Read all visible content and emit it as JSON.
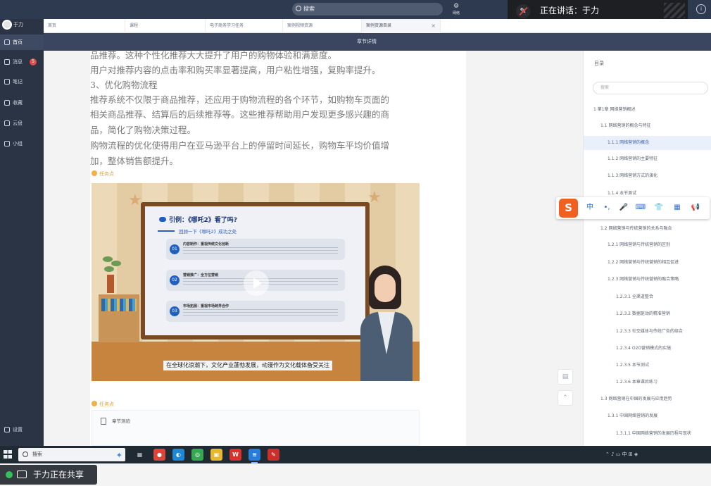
{
  "topbar": {
    "search_text": "搜索",
    "net_label": "网络",
    "speaking_text": "正在讲话：于力"
  },
  "sidebar": {
    "user_name": "于力",
    "items": [
      {
        "label": "首页",
        "active": true
      },
      {
        "label": "消息",
        "badge": "5"
      },
      {
        "label": "笔记"
      },
      {
        "label": "收藏"
      },
      {
        "label": "云盘"
      },
      {
        "label": "小组"
      }
    ],
    "settings_label": "设置"
  },
  "tabs": [
    {
      "label": "首页"
    },
    {
      "label": "课程"
    },
    {
      "label": "电子商务学习任务"
    },
    {
      "label": "案例视频资源"
    },
    {
      "label": "案例资源目录",
      "active": true,
      "close": "×"
    }
  ],
  "section_title": "章节详情",
  "article": {
    "lines": [
      "品推荐。这种个性化推荐大大提升了用户的购物体验和满意度。",
      "用户对推荐内容的点击率和购买率显著提高，用户粘性增强，复购率提升。",
      "3、优化购物流程",
      "推荐系统不仅限于商品推荐，还应用于购物流程的各个环节，如购物车页面的",
      "相关商品推荐、结算后的后续推荐等。这些推荐帮助用户发现更多感兴趣的商",
      "品，简化了购物决策过程。",
      "购物流程的优化使得用户在亚马逊平台上的停留时间延长，购物车平均价值增",
      "加，整体销售额提升。"
    ],
    "marker1": "任务点",
    "marker2": "任务点",
    "reference_label": "章节测验"
  },
  "video": {
    "board_title": "引例：《哪吒2》看了吗?",
    "board_subtitle": "回顾一下《哪吒2》成功之处",
    "cards": [
      {
        "num": "01",
        "title": "内容制作：重视传统文化创新"
      },
      {
        "num": "02",
        "title": "营销推广：全方位营销"
      },
      {
        "num": "03",
        "title": "市场拓展：重视市场跨界合作"
      }
    ],
    "subtitle": "在全球化浪潮下，文化产业蓬勃发展，动漫作为文化载体备受关注"
  },
  "toc": {
    "title": "目录",
    "search_placeholder": "搜索",
    "items": [
      {
        "label": "1 第1章 网络营销概述",
        "level": 1
      },
      {
        "label": "1.1 网络营销的概念与特征",
        "level": 2
      },
      {
        "label": "1.1.1 网络营销的概念",
        "level": 3,
        "selected": true
      },
      {
        "label": "1.1.2 网络营销的主要特征",
        "level": 3
      },
      {
        "label": "1.1.3 网络营销方式的演化",
        "level": 3
      },
      {
        "label": "1.1.4 本节测试",
        "level": 3
      },
      {
        "label": "1.2 网络营销与传统营销的关系与融合",
        "level": 2
      },
      {
        "label": "1.2.1 网络营销与传统营销的区别",
        "level": 3
      },
      {
        "label": "1.2.2 网络营销与传统营销的相互促进",
        "level": 3
      },
      {
        "label": "1.2.3 网络营销与传统营销的融合策略",
        "level": 3
      },
      {
        "label": "1.2.3.1 全渠道整合",
        "level": 4
      },
      {
        "label": "1.2.3.2 数据驱动的精准营销",
        "level": 4
      },
      {
        "label": "1.2.3.3 社交媒体与传统广告的结合",
        "level": 4
      },
      {
        "label": "1.2.3.4 O2O营销模式的实施",
        "level": 4
      },
      {
        "label": "1.2.3.5 本节测试",
        "level": 4
      },
      {
        "label": "1.2.3.6 本章课后练习",
        "level": 4
      },
      {
        "label": "1.3 网络营销在中国的发展与应用趋势",
        "level": 2
      },
      {
        "label": "1.3.1 中国网络营销的发展",
        "level": 3
      },
      {
        "label": "1.3.1.1 中国网络营销的发展历程与现状",
        "level": 4
      }
    ]
  },
  "ime": {
    "logo": "S",
    "items": [
      "中",
      "•,",
      "🎤",
      "⌨",
      "👕",
      "▦",
      "📢"
    ]
  },
  "taskbar": {
    "search_text": "搜索",
    "apps": [
      "▦",
      "●",
      "◐",
      "◎",
      "▣",
      "W",
      "≋",
      "✎"
    ],
    "tray_text": "⌃ ♪ ▭ 中 ⊞ ◈"
  },
  "share": {
    "text": "于力正在共享"
  },
  "colors": {
    "sidebar": "#2b3445",
    "topbar": "#2e3a4f",
    "accent": "#3c64b0",
    "task_marker": "#e6a23c"
  }
}
